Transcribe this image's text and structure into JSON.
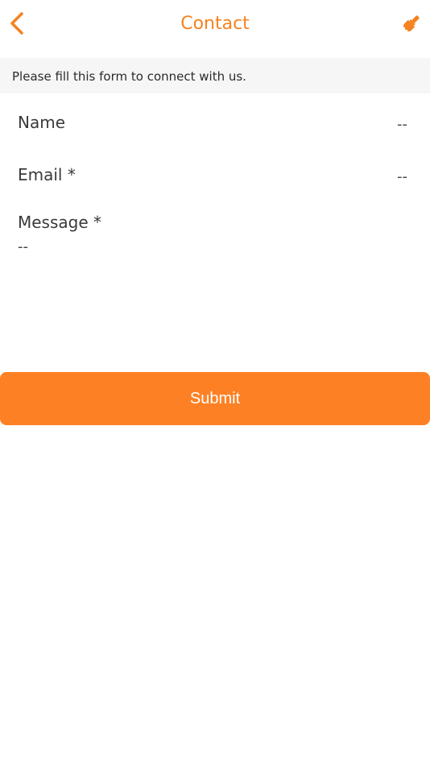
{
  "header": {
    "title": "Contact",
    "back_icon": "chevron-left-icon",
    "theme_icon": "paint-brush-icon",
    "accent_color": "#f5821f"
  },
  "info": {
    "text": "Please fill this form to connect with us."
  },
  "form": {
    "name": {
      "label": "Name",
      "value": "--"
    },
    "email": {
      "label": "Email *",
      "value": "--"
    },
    "message": {
      "label": "Message *",
      "value": "--"
    }
  },
  "submit": {
    "label": "Submit",
    "color": "#fd8124"
  }
}
